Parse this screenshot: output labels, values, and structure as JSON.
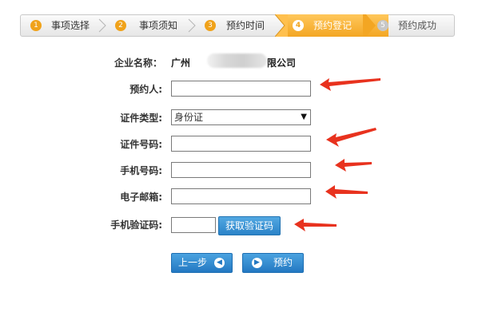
{
  "steps": [
    {
      "number": "1",
      "label": "事项选择",
      "state": "done"
    },
    {
      "number": "2",
      "label": "事项须知",
      "state": "done"
    },
    {
      "number": "3",
      "label": "预约时间",
      "state": "done"
    },
    {
      "number": "4",
      "label": "预约登记",
      "state": "active"
    },
    {
      "number": "5",
      "label": "预约成功",
      "state": "todo"
    }
  ],
  "form": {
    "company_label": "企业名称：",
    "company_prefix": "广州",
    "company_suffix": "限公司",
    "name_label": "预约人:",
    "name_value": "",
    "id_type_label": "证件类型:",
    "id_type_selected": "身份证",
    "id_number_label": "证件号码:",
    "id_number_value": "",
    "phone_label": "手机号码:",
    "phone_value": "",
    "email_label": "电子邮箱:",
    "email_value": "",
    "sms_code_label": "手机验证码:",
    "sms_code_value": "",
    "get_code_button": "获取验证码"
  },
  "actions": {
    "prev_label": "上一步",
    "submit_label": "预约"
  },
  "colors": {
    "active_step": "#f3a623",
    "button_blue": "#2b83c8",
    "annotation_arrow": "#e8321e"
  },
  "icons": {
    "caret": "▼",
    "prev": "◀",
    "submit": "▶"
  }
}
